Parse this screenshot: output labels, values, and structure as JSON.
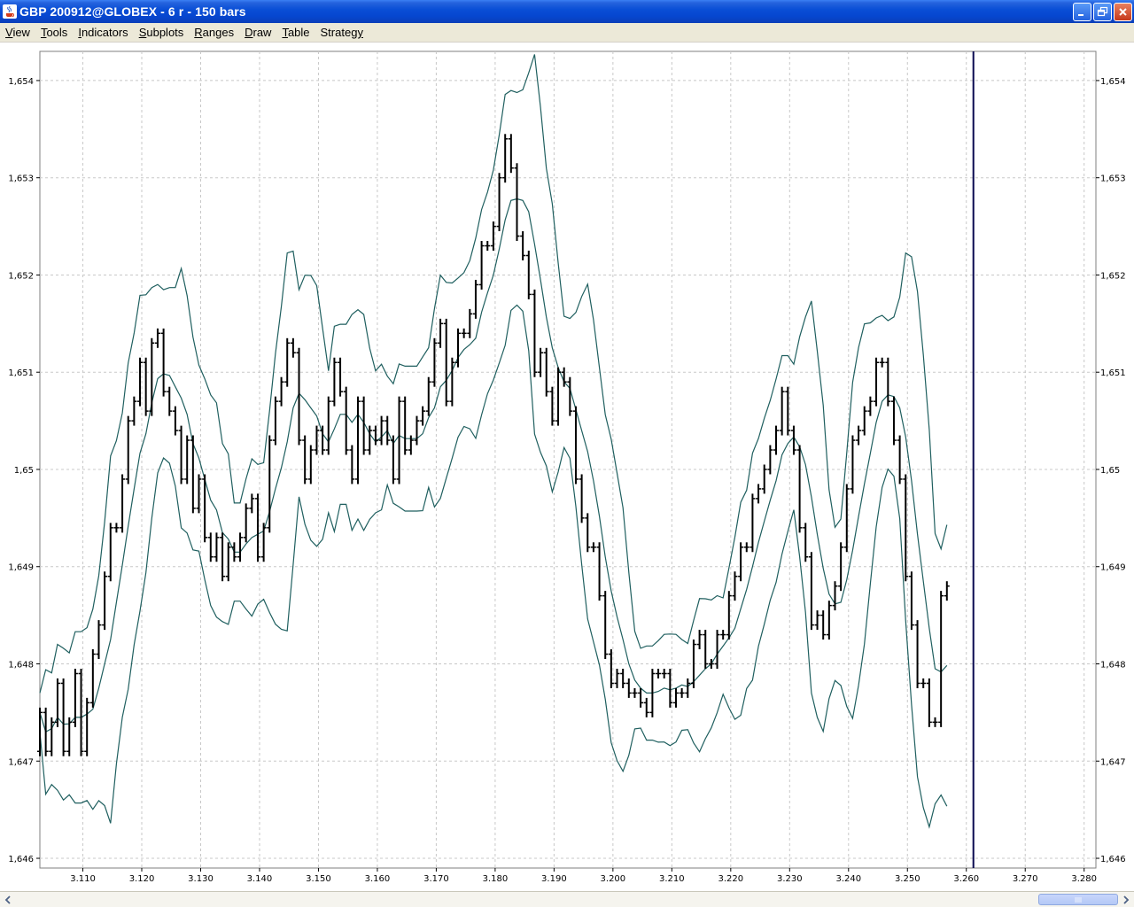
{
  "window": {
    "title": "GBP 200912@GLOBEX - 6 r - 150 bars"
  },
  "menu": {
    "items": [
      {
        "id": "view",
        "label": "View",
        "mnemonic": 0
      },
      {
        "id": "tools",
        "label": "Tools",
        "mnemonic": 0
      },
      {
        "id": "indicators",
        "label": "Indicators",
        "mnemonic": 0
      },
      {
        "id": "subplots",
        "label": "Subplots",
        "mnemonic": 0
      },
      {
        "id": "ranges",
        "label": "Ranges",
        "mnemonic": 0
      },
      {
        "id": "draw",
        "label": "Draw",
        "mnemonic": 0
      },
      {
        "id": "table",
        "label": "Table",
        "mnemonic": 0
      },
      {
        "id": "strategy",
        "label": "Strategy",
        "mnemonic": 7
      }
    ]
  },
  "colors": {
    "bars": "#000000",
    "bands": "#1F5F5F",
    "cursor": "#0A0A50",
    "grid": "#C8C8C8"
  },
  "chart_data": {
    "type": "bar",
    "x_ticks": [
      "3.110",
      "3.120",
      "3.130",
      "3.140",
      "3.150",
      "3.160",
      "3.170",
      "3.180",
      "3.190",
      "3.200",
      "3.210",
      "3.220",
      "3.230",
      "3.240",
      "3.250",
      "3.260",
      "3.270",
      "3.280"
    ],
    "y_ticks": [
      "1,654",
      "1,653",
      "1,652",
      "1,651",
      "1,65",
      "1,649",
      "1,648",
      "1,647",
      "1,646"
    ],
    "xlim": [
      3102.7,
      3282
    ],
    "ylim": [
      1.6459,
      1.6543
    ],
    "cursor_x": 3261.2,
    "grid": true,
    "series": [
      {
        "kind": "ohlc_close",
        "values": [
          1.6475,
          1.6471,
          1.6474,
          1.6478,
          1.6471,
          1.6474,
          1.6479,
          1.6471,
          1.6476,
          1.6481,
          1.6484,
          1.6489,
          1.6494,
          1.6494,
          1.6499,
          1.6505,
          1.6507,
          1.6511,
          1.6506,
          1.6513,
          1.6514,
          1.6508,
          1.6506,
          1.6504,
          1.6499,
          1.6503,
          1.6496,
          1.6499,
          1.6493,
          1.6491,
          1.6493,
          1.6489,
          1.6492,
          1.6491,
          1.6493,
          1.6496,
          1.6497,
          1.6491,
          1.6494,
          1.6503,
          1.6507,
          1.6509,
          1.6513,
          1.6512,
          1.6503,
          1.6499,
          1.6502,
          1.6504,
          1.6502,
          1.6507,
          1.6511,
          1.6508,
          1.6502,
          1.6499,
          1.6507,
          1.6502,
          1.6504,
          1.6503,
          1.6505,
          1.6503,
          1.6499,
          1.6507,
          1.6502,
          1.6503,
          1.6505,
          1.6506,
          1.6509,
          1.6513,
          1.6515,
          1.6507,
          1.6511,
          1.6514,
          1.6514,
          1.6516,
          1.6519,
          1.6523,
          1.6523,
          1.6525,
          1.653,
          1.6534,
          1.6531,
          1.6524,
          1.6522,
          1.6518,
          1.651,
          1.6512,
          1.6508,
          1.6505,
          1.651,
          1.6509,
          1.6506,
          1.6499,
          1.6495,
          1.6492,
          1.6492,
          1.6487,
          1.6481,
          1.6478,
          1.6479,
          1.6478,
          1.6477,
          1.6477,
          1.6476,
          1.6475,
          1.6479,
          1.6479,
          1.6479,
          1.6476,
          1.6477,
          1.6477,
          1.6478,
          1.6482,
          1.6483,
          1.648,
          1.648,
          1.6483,
          1.6483,
          1.6487,
          1.6489,
          1.6492,
          1.6492,
          1.6497,
          1.6498,
          1.65,
          1.6502,
          1.6504,
          1.6508,
          1.6504,
          1.6502,
          1.6494,
          1.6491,
          1.6484,
          1.6485,
          1.6483,
          1.6486,
          1.6488,
          1.6492,
          1.6498,
          1.6503,
          1.6504,
          1.6506,
          1.6507,
          1.6511,
          1.6511,
          1.6507,
          1.6503,
          1.6499,
          1.6489,
          1.6484,
          1.6478,
          1.6478,
          1.6474,
          1.6474,
          1.6487,
          1.6488
        ]
      }
    ]
  },
  "scrollbar": {
    "left_arrow": "scroll-left-icon",
    "right_arrow": "scroll-right-icon"
  }
}
